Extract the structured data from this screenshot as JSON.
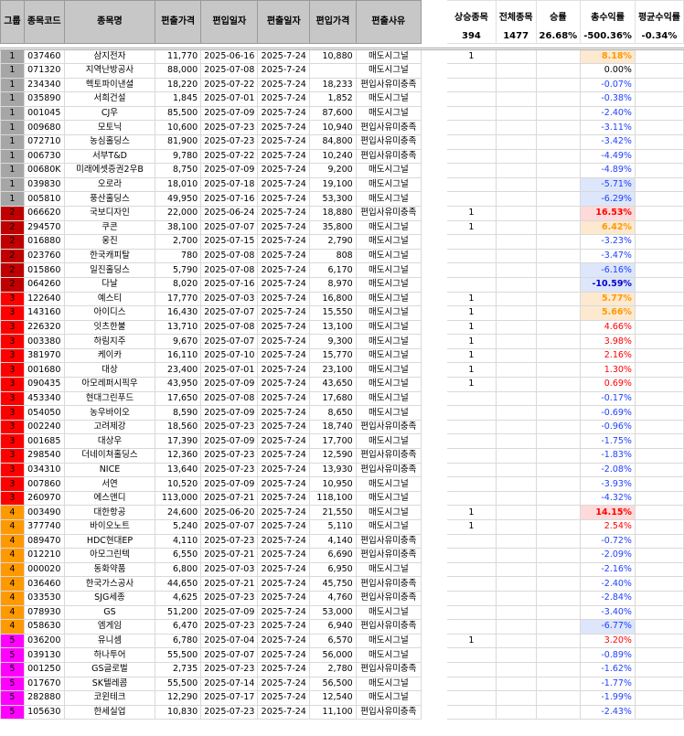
{
  "headers": {
    "group": "그룹",
    "code": "종목코드",
    "name": "종목명",
    "in_price": "편출가격",
    "in_date": "편입일자",
    "out_date": "편출일자",
    "buy_price": "편입가격",
    "reason": "편출사유"
  },
  "stats": {
    "up_label": "상승종목",
    "up_value": "394",
    "total_label": "전체종목",
    "total_value": "1477",
    "winrate_label": "승률",
    "winrate_value": "26.68%",
    "total_ret_label": "총수익률",
    "total_ret_value": "-500.36%",
    "avg_ret_label": "평균수익률",
    "avg_ret_value": "-0.34%"
  },
  "colors": {
    "g1": "#a6a6a6",
    "g2": "#c00000",
    "g3": "#ff0000",
    "g4": "#ff9900",
    "g5": "#ff00ff"
  },
  "rows": [
    {
      "g": "1",
      "code": "037460",
      "name": "삼지전자",
      "p1": "11,770",
      "d1": "2025-06-16",
      "d2": "2025-7-24",
      "p2": "10,880",
      "reason": "매도시그널",
      "up": "1",
      "ret": "8.18%"
    },
    {
      "g": "1",
      "code": "071320",
      "name": "지역난방공사",
      "p1": "88,000",
      "d1": "2025-07-08",
      "d2": "2025-7-24",
      "p2": "",
      "reason": "매도시그널",
      "up": "",
      "ret": "0.00%"
    },
    {
      "g": "1",
      "code": "234340",
      "name": "헥토파이낸셜",
      "p1": "18,220",
      "d1": "2025-07-22",
      "d2": "2025-7-24",
      "p2": "18,233",
      "reason": "편입사유미충족",
      "up": "",
      "ret": "-0.07%"
    },
    {
      "g": "1",
      "code": "035890",
      "name": "서희건설",
      "p1": "1,845",
      "d1": "2025-07-01",
      "d2": "2025-7-24",
      "p2": "1,852",
      "reason": "매도시그널",
      "up": "",
      "ret": "-0.38%"
    },
    {
      "g": "1",
      "code": "001045",
      "name": "CJ우",
      "p1": "85,500",
      "d1": "2025-07-09",
      "d2": "2025-7-24",
      "p2": "87,600",
      "reason": "매도시그널",
      "up": "",
      "ret": "-2.40%"
    },
    {
      "g": "1",
      "code": "009680",
      "name": "모토닉",
      "p1": "10,600",
      "d1": "2025-07-23",
      "d2": "2025-7-24",
      "p2": "10,940",
      "reason": "편입사유미충족",
      "up": "",
      "ret": "-3.11%"
    },
    {
      "g": "1",
      "code": "072710",
      "name": "농심홀딩스",
      "p1": "81,900",
      "d1": "2025-07-23",
      "d2": "2025-7-24",
      "p2": "84,800",
      "reason": "편입사유미충족",
      "up": "",
      "ret": "-3.42%"
    },
    {
      "g": "1",
      "code": "006730",
      "name": "서부T&D",
      "p1": "9,780",
      "d1": "2025-07-22",
      "d2": "2025-7-24",
      "p2": "10,240",
      "reason": "편입사유미충족",
      "up": "",
      "ret": "-4.49%"
    },
    {
      "g": "1",
      "code": "00680K",
      "name": "미래에셋증권2우B",
      "p1": "8,750",
      "d1": "2025-07-09",
      "d2": "2025-7-24",
      "p2": "9,200",
      "reason": "매도시그널",
      "up": "",
      "ret": "-4.89%"
    },
    {
      "g": "1",
      "code": "039830",
      "name": "오로라",
      "p1": "18,010",
      "d1": "2025-07-18",
      "d2": "2025-7-24",
      "p2": "19,100",
      "reason": "매도시그널",
      "up": "",
      "ret": "-5.71%"
    },
    {
      "g": "1",
      "code": "005810",
      "name": "풍산홀딩스",
      "p1": "49,950",
      "d1": "2025-07-16",
      "d2": "2025-7-24",
      "p2": "53,300",
      "reason": "매도시그널",
      "up": "",
      "ret": "-6.29%"
    },
    {
      "g": "2",
      "code": "066620",
      "name": "국보디자인",
      "p1": "22,000",
      "d1": "2025-06-24",
      "d2": "2025-7-24",
      "p2": "18,880",
      "reason": "편입사유미충족",
      "up": "1",
      "ret": "16.53%"
    },
    {
      "g": "2",
      "code": "294570",
      "name": "쿠콘",
      "p1": "38,100",
      "d1": "2025-07-07",
      "d2": "2025-7-24",
      "p2": "35,800",
      "reason": "매도시그널",
      "up": "1",
      "ret": "6.42%"
    },
    {
      "g": "2",
      "code": "016880",
      "name": "웅진",
      "p1": "2,700",
      "d1": "2025-07-15",
      "d2": "2025-7-24",
      "p2": "2,790",
      "reason": "매도시그널",
      "up": "",
      "ret": "-3.23%"
    },
    {
      "g": "2",
      "code": "023760",
      "name": "한국캐피탈",
      "p1": "780",
      "d1": "2025-07-08",
      "d2": "2025-7-24",
      "p2": "808",
      "reason": "매도시그널",
      "up": "",
      "ret": "-3.47%"
    },
    {
      "g": "2",
      "code": "015860",
      "name": "일진홀딩스",
      "p1": "5,790",
      "d1": "2025-07-08",
      "d2": "2025-7-24",
      "p2": "6,170",
      "reason": "매도시그널",
      "up": "",
      "ret": "-6.16%"
    },
    {
      "g": "2",
      "code": "064260",
      "name": "다날",
      "p1": "8,020",
      "d1": "2025-07-16",
      "d2": "2025-7-24",
      "p2": "8,970",
      "reason": "매도시그널",
      "up": "",
      "ret": "-10.59%"
    },
    {
      "g": "3",
      "code": "122640",
      "name": "예스티",
      "p1": "17,770",
      "d1": "2025-07-03",
      "d2": "2025-7-24",
      "p2": "16,800",
      "reason": "매도시그널",
      "up": "1",
      "ret": "5.77%"
    },
    {
      "g": "3",
      "code": "143160",
      "name": "아이디스",
      "p1": "16,430",
      "d1": "2025-07-07",
      "d2": "2025-7-24",
      "p2": "15,550",
      "reason": "매도시그널",
      "up": "1",
      "ret": "5.66%"
    },
    {
      "g": "3",
      "code": "226320",
      "name": "잇츠한불",
      "p1": "13,710",
      "d1": "2025-07-08",
      "d2": "2025-7-24",
      "p2": "13,100",
      "reason": "매도시그널",
      "up": "1",
      "ret": "4.66%"
    },
    {
      "g": "3",
      "code": "003380",
      "name": "하림지주",
      "p1": "9,670",
      "d1": "2025-07-07",
      "d2": "2025-7-24",
      "p2": "9,300",
      "reason": "매도시그널",
      "up": "1",
      "ret": "3.98%"
    },
    {
      "g": "3",
      "code": "381970",
      "name": "케이카",
      "p1": "16,110",
      "d1": "2025-07-10",
      "d2": "2025-7-24",
      "p2": "15,770",
      "reason": "매도시그널",
      "up": "1",
      "ret": "2.16%"
    },
    {
      "g": "3",
      "code": "001680",
      "name": "대상",
      "p1": "23,400",
      "d1": "2025-07-01",
      "d2": "2025-7-24",
      "p2": "23,100",
      "reason": "매도시그널",
      "up": "1",
      "ret": "1.30%"
    },
    {
      "g": "3",
      "code": "090435",
      "name": "아모레퍼시픽우",
      "p1": "43,950",
      "d1": "2025-07-09",
      "d2": "2025-7-24",
      "p2": "43,650",
      "reason": "매도시그널",
      "up": "1",
      "ret": "0.69%"
    },
    {
      "g": "3",
      "code": "453340",
      "name": "현대그린푸드",
      "p1": "17,650",
      "d1": "2025-07-08",
      "d2": "2025-7-24",
      "p2": "17,680",
      "reason": "매도시그널",
      "up": "",
      "ret": "-0.17%"
    },
    {
      "g": "3",
      "code": "054050",
      "name": "농우바이오",
      "p1": "8,590",
      "d1": "2025-07-09",
      "d2": "2025-7-24",
      "p2": "8,650",
      "reason": "매도시그널",
      "up": "",
      "ret": "-0.69%"
    },
    {
      "g": "3",
      "code": "002240",
      "name": "고려제강",
      "p1": "18,560",
      "d1": "2025-07-23",
      "d2": "2025-7-24",
      "p2": "18,740",
      "reason": "편입사유미충족",
      "up": "",
      "ret": "-0.96%"
    },
    {
      "g": "3",
      "code": "001685",
      "name": "대상우",
      "p1": "17,390",
      "d1": "2025-07-09",
      "d2": "2025-7-24",
      "p2": "17,700",
      "reason": "매도시그널",
      "up": "",
      "ret": "-1.75%"
    },
    {
      "g": "3",
      "code": "298540",
      "name": "더네이쳐홀딩스",
      "p1": "12,360",
      "d1": "2025-07-23",
      "d2": "2025-7-24",
      "p2": "12,590",
      "reason": "편입사유미충족",
      "up": "",
      "ret": "-1.83%"
    },
    {
      "g": "3",
      "code": "034310",
      "name": "NICE",
      "p1": "13,640",
      "d1": "2025-07-23",
      "d2": "2025-7-24",
      "p2": "13,930",
      "reason": "편입사유미충족",
      "up": "",
      "ret": "-2.08%"
    },
    {
      "g": "3",
      "code": "007860",
      "name": "서연",
      "p1": "10,520",
      "d1": "2025-07-09",
      "d2": "2025-7-24",
      "p2": "10,950",
      "reason": "매도시그널",
      "up": "",
      "ret": "-3.93%"
    },
    {
      "g": "3",
      "code": "260970",
      "name": "에스앤디",
      "p1": "113,000",
      "d1": "2025-07-21",
      "d2": "2025-7-24",
      "p2": "118,100",
      "reason": "매도시그널",
      "up": "",
      "ret": "-4.32%"
    },
    {
      "g": "4",
      "code": "003490",
      "name": "대한항공",
      "p1": "24,600",
      "d1": "2025-06-20",
      "d2": "2025-7-24",
      "p2": "21,550",
      "reason": "매도시그널",
      "up": "1",
      "ret": "14.15%"
    },
    {
      "g": "4",
      "code": "377740",
      "name": "바이오노트",
      "p1": "5,240",
      "d1": "2025-07-07",
      "d2": "2025-7-24",
      "p2": "5,110",
      "reason": "매도시그널",
      "up": "1",
      "ret": "2.54%"
    },
    {
      "g": "4",
      "code": "089470",
      "name": "HDC현대EP",
      "p1": "4,110",
      "d1": "2025-07-23",
      "d2": "2025-7-24",
      "p2": "4,140",
      "reason": "편입사유미충족",
      "up": "",
      "ret": "-0.72%"
    },
    {
      "g": "4",
      "code": "012210",
      "name": "아모그린텍",
      "p1": "6,550",
      "d1": "2025-07-21",
      "d2": "2025-7-24",
      "p2": "6,690",
      "reason": "편입사유미충족",
      "up": "",
      "ret": "-2.09%"
    },
    {
      "g": "4",
      "code": "000020",
      "name": "동화약품",
      "p1": "6,800",
      "d1": "2025-07-03",
      "d2": "2025-7-24",
      "p2": "6,950",
      "reason": "매도시그널",
      "up": "",
      "ret": "-2.16%"
    },
    {
      "g": "4",
      "code": "036460",
      "name": "한국가스공사",
      "p1": "44,650",
      "d1": "2025-07-21",
      "d2": "2025-7-24",
      "p2": "45,750",
      "reason": "편입사유미충족",
      "up": "",
      "ret": "-2.40%"
    },
    {
      "g": "4",
      "code": "033530",
      "name": "SJG세종",
      "p1": "4,625",
      "d1": "2025-07-23",
      "d2": "2025-7-24",
      "p2": "4,760",
      "reason": "편입사유미충족",
      "up": "",
      "ret": "-2.84%"
    },
    {
      "g": "4",
      "code": "078930",
      "name": "GS",
      "p1": "51,200",
      "d1": "2025-07-09",
      "d2": "2025-7-24",
      "p2": "53,000",
      "reason": "매도시그널",
      "up": "",
      "ret": "-3.40%"
    },
    {
      "g": "4",
      "code": "058630",
      "name": "엠게임",
      "p1": "6,470",
      "d1": "2025-07-23",
      "d2": "2025-7-24",
      "p2": "6,940",
      "reason": "편입사유미충족",
      "up": "",
      "ret": "-6.77%"
    },
    {
      "g": "5",
      "code": "036200",
      "name": "유니셈",
      "p1": "6,780",
      "d1": "2025-07-04",
      "d2": "2025-7-24",
      "p2": "6,570",
      "reason": "매도시그널",
      "up": "1",
      "ret": "3.20%"
    },
    {
      "g": "5",
      "code": "039130",
      "name": "하나투어",
      "p1": "55,500",
      "d1": "2025-07-07",
      "d2": "2025-7-24",
      "p2": "56,000",
      "reason": "매도시그널",
      "up": "",
      "ret": "-0.89%"
    },
    {
      "g": "5",
      "code": "001250",
      "name": "GS글로벌",
      "p1": "2,735",
      "d1": "2025-07-23",
      "d2": "2025-7-24",
      "p2": "2,780",
      "reason": "편입사유미충족",
      "up": "",
      "ret": "-1.62%"
    },
    {
      "g": "5",
      "code": "017670",
      "name": "SK텔레콤",
      "p1": "55,500",
      "d1": "2025-07-14",
      "d2": "2025-7-24",
      "p2": "56,500",
      "reason": "매도시그널",
      "up": "",
      "ret": "-1.77%"
    },
    {
      "g": "5",
      "code": "282880",
      "name": "코윈테크",
      "p1": "12,290",
      "d1": "2025-07-17",
      "d2": "2025-7-24",
      "p2": "12,540",
      "reason": "매도시그널",
      "up": "",
      "ret": "-1.99%"
    },
    {
      "g": "5",
      "code": "105630",
      "name": "한세실업",
      "p1": "10,830",
      "d1": "2025-07-23",
      "d2": "2025-7-24",
      "p2": "11,100",
      "reason": "편입사유미충족",
      "up": "",
      "ret": "-2.43%"
    }
  ]
}
